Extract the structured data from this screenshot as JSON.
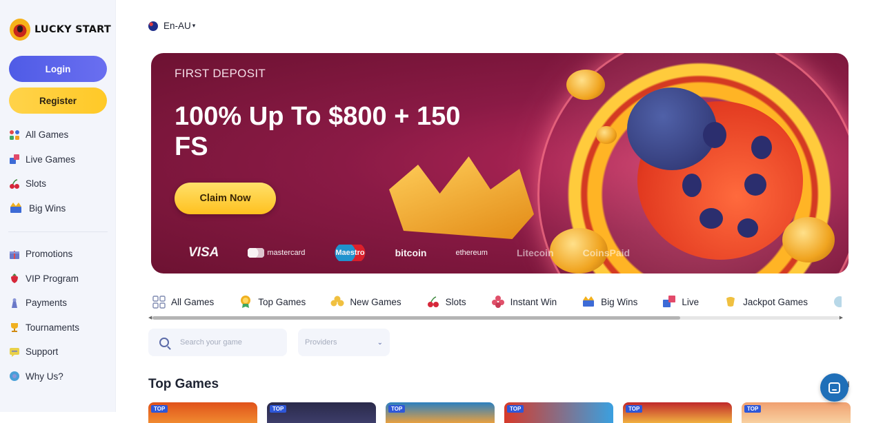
{
  "brand": {
    "name": "LUCKY START"
  },
  "auth": {
    "login_label": "Login",
    "register_label": "Register"
  },
  "sidebar": {
    "primary": [
      {
        "label": "All Games",
        "icon": "all-games-icon"
      },
      {
        "label": "Live Games",
        "icon": "live-games-icon"
      },
      {
        "label": "Slots",
        "icon": "cherries-icon"
      },
      {
        "label": "Big Wins",
        "icon": "big-wins-icon"
      }
    ],
    "secondary": [
      {
        "label": "Promotions",
        "icon": "gift-icon"
      },
      {
        "label": "VIP Program",
        "icon": "strawberry-icon"
      },
      {
        "label": "Payments",
        "icon": "payments-icon"
      },
      {
        "label": "Tournaments",
        "icon": "trophy-icon"
      },
      {
        "label": "Support",
        "icon": "support-icon"
      },
      {
        "label": "Why Us?",
        "icon": "info-icon"
      }
    ]
  },
  "language": {
    "label": "En-AU"
  },
  "banner": {
    "subtitle": "FIRST DEPOSIT",
    "title": "100% Up To $800 + 150 FS",
    "cta_label": "Claim Now",
    "payments": [
      "VISA",
      "mastercard",
      "Maestro",
      "bitcoin",
      "ethereum",
      "Litecoin",
      "CoinsPaid"
    ]
  },
  "categories": [
    {
      "label": "All Games",
      "icon": "grid-icon"
    },
    {
      "label": "Top Games",
      "icon": "medal-icon"
    },
    {
      "label": "New Games",
      "icon": "clover-icon"
    },
    {
      "label": "Slots",
      "icon": "cherries-icon"
    },
    {
      "label": "Instant Win",
      "icon": "flower-icon"
    },
    {
      "label": "Big Wins",
      "icon": "big-wins-icon"
    },
    {
      "label": "Live",
      "icon": "live-icon"
    },
    {
      "label": "Jackpot Games",
      "icon": "jackpot-icon"
    }
  ],
  "search": {
    "placeholder": "Search your game"
  },
  "providers": {
    "placeholder": "Providers"
  },
  "top_games": {
    "title": "Top Games",
    "view_all_fragment": "ll",
    "badge": "TOP",
    "tiles": [
      "#e0521a",
      "#2a2a4a",
      "#2b7fc0",
      "#d63a2a",
      "#c0282a",
      "#f0a070"
    ]
  },
  "colors": {
    "accent_blue": "#5a63ea",
    "accent_yellow": "#ffc927",
    "banner": "#8a1a45"
  }
}
